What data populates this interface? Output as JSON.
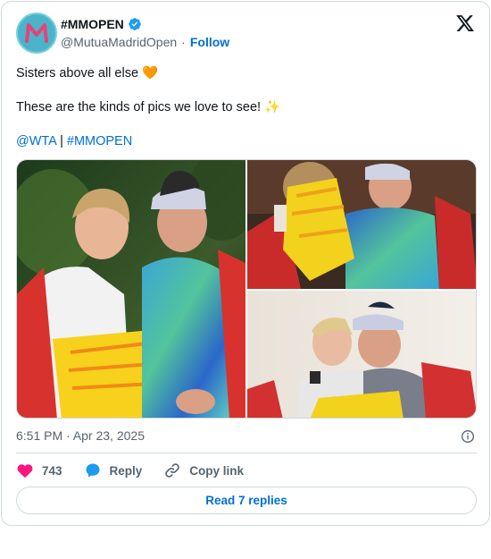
{
  "account": {
    "display_name": "#MMOPEN",
    "handle": "@MutuaMadridOpen",
    "separator": "·",
    "follow_label": "Follow",
    "avatar_letter": "M"
  },
  "post": {
    "line1": "Sisters above all else 🧡",
    "line2": "These are the kinds of pics we love to see! ✨",
    "mention": "@WTA",
    "pipe": " | ",
    "hashtag": "#MMOPEN"
  },
  "media": {
    "photo_count": 3
  },
  "meta": {
    "timestamp": "6:51 PM · Apr 23, 2025"
  },
  "actions": {
    "like_count": "743",
    "reply_label": "Reply",
    "copy_label": "Copy link"
  },
  "footer": {
    "read_replies_label": "Read 7 replies"
  },
  "colors": {
    "accent": "#006fd6",
    "like": "#f91880",
    "border": "#cfd9de",
    "muted": "#536471"
  },
  "icons": [
    "verified-badge-icon",
    "x-logo-icon",
    "info-icon",
    "heart-icon",
    "reply-bubble-icon",
    "link-icon"
  ]
}
